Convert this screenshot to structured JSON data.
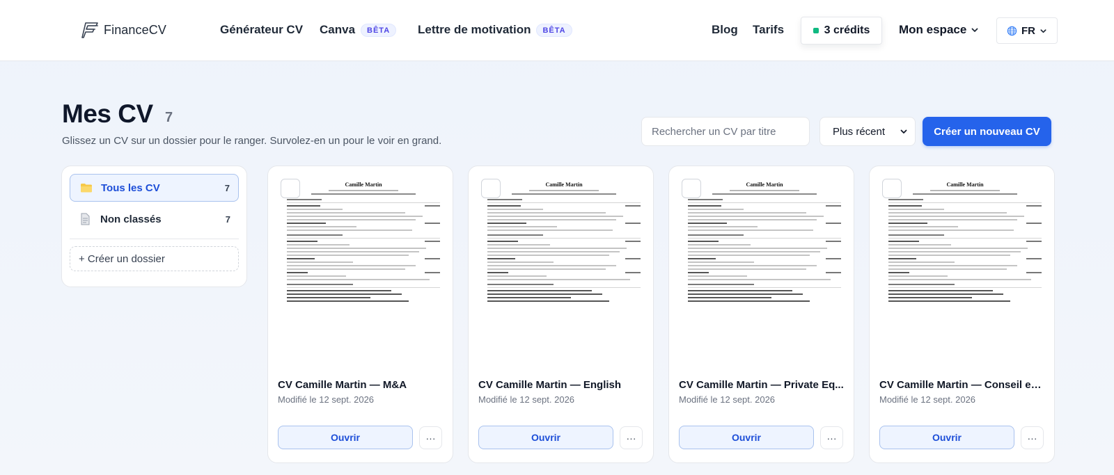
{
  "header": {
    "logo_text": "FinanceCV",
    "nav": {
      "generator": "Générateur CV",
      "canva": "Canva",
      "canva_badge": "BÊTA",
      "letter": "Lettre de motivation",
      "letter_badge": "BÊTA",
      "blog": "Blog",
      "pricing": "Tarifs"
    },
    "credits_label": "3 crédits",
    "credits_color": "#10b981",
    "account_label": "Mon espace",
    "language": "FR"
  },
  "page": {
    "title": "Mes CV",
    "count": "7",
    "subtitle": "Glissez un CV sur un dossier pour le ranger. Survolez-en un pour le voir en grand.",
    "search_placeholder": "Rechercher un CV par titre",
    "sort_value": "Plus récent",
    "create_button": "Créer un nouveau CV"
  },
  "sidebar": {
    "folders": [
      {
        "label": "Tous les CV",
        "count": "7",
        "icon": "folder-icon",
        "active": true
      },
      {
        "label": "Non classés",
        "count": "7",
        "icon": "document-icon",
        "active": false
      }
    ],
    "create_folder": "+ Créer un dossier"
  },
  "cards": [
    {
      "preview_name": "Camille Martin",
      "title": "CV Camille Martin — M&A",
      "modified": "Modifié le 12 sept. 2026",
      "open_label": "Ouvrir",
      "more_label": "···"
    },
    {
      "preview_name": "Camille Martin",
      "title": "CV Camille Martin — English",
      "modified": "Modifié le 12 sept. 2026",
      "open_label": "Ouvrir",
      "more_label": "···"
    },
    {
      "preview_name": "Camille Martin",
      "title": "CV Camille Martin — Private Eq...",
      "modified": "Modifié le 12 sept. 2026",
      "open_label": "Ouvrir",
      "more_label": "···"
    },
    {
      "preview_name": "Camille Martin",
      "title": "CV Camille Martin — Conseil en...",
      "modified": "Modifié le 12 sept. 2026",
      "open_label": "Ouvrir",
      "more_label": "···"
    }
  ],
  "colors": {
    "primary": "#2563eb",
    "active_folder_bg": "#eef4ff",
    "beta_badge": "#4f46e5"
  }
}
